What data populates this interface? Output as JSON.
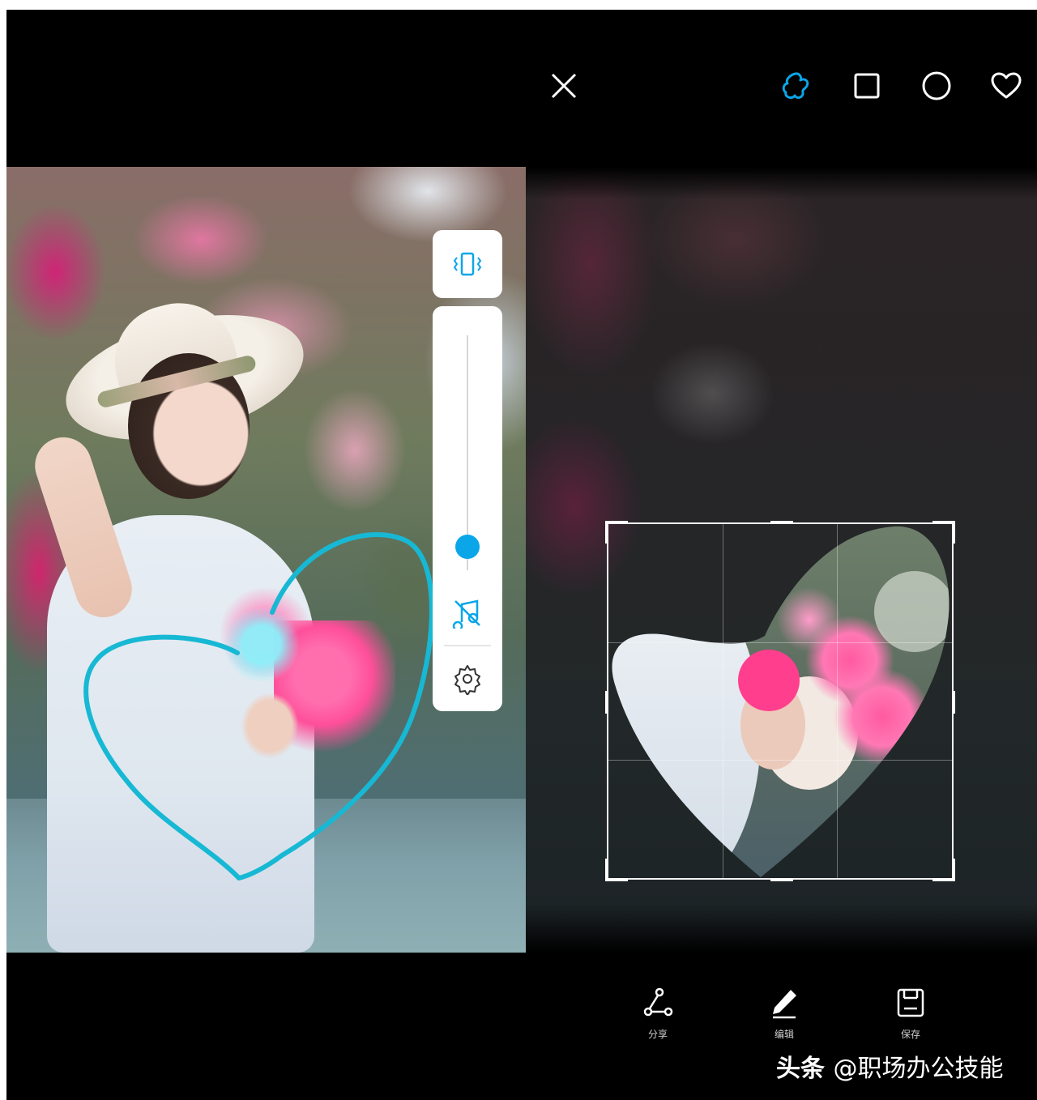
{
  "colors": {
    "accent": "#0aa6e8",
    "background": "#000000",
    "icon_white": "#ffffff",
    "heart_stroke": "#17b8d4"
  },
  "left_screen": {
    "panel_icons": [
      "vibrate-icon",
      "mute-icon",
      "settings-icon"
    ],
    "slider_level": 0.1
  },
  "right_screen": {
    "top_toolbar": {
      "close_icon": "close-icon",
      "shapes": [
        "freeform-shape-icon",
        "square-shape-icon",
        "circle-shape-icon",
        "heart-shape-icon"
      ],
      "selected_shape": "freeform-shape-icon"
    },
    "bottom_actions": [
      {
        "icon": "share-icon",
        "label": "分享"
      },
      {
        "icon": "edit-icon",
        "label": "编辑"
      },
      {
        "icon": "save-icon",
        "label": "保存"
      }
    ]
  },
  "watermark": {
    "brand": "头条",
    "handle": "@职场办公技能"
  }
}
